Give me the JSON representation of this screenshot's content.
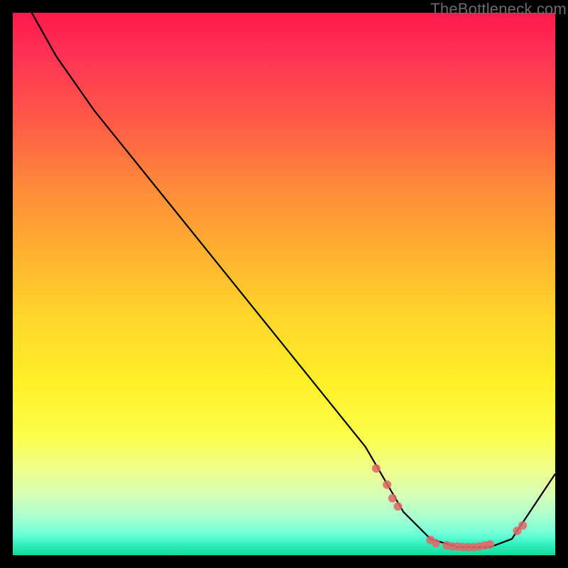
{
  "watermark": "TheBottleneck.com",
  "chart_data": {
    "type": "line",
    "title": "",
    "xlabel": "",
    "ylabel": "",
    "xlim": [
      0,
      100
    ],
    "ylim": [
      0,
      100
    ],
    "series": [
      {
        "name": "curve",
        "points": [
          {
            "x": 3.5,
            "y": 100
          },
          {
            "x": 8,
            "y": 92
          },
          {
            "x": 15,
            "y": 82
          },
          {
            "x": 65,
            "y": 20
          },
          {
            "x": 72,
            "y": 8
          },
          {
            "x": 77,
            "y": 3
          },
          {
            "x": 82,
            "y": 1.5
          },
          {
            "x": 88,
            "y": 1.5
          },
          {
            "x": 92,
            "y": 3
          },
          {
            "x": 100,
            "y": 15
          }
        ]
      },
      {
        "name": "dots",
        "points": [
          {
            "x": 67,
            "y": 16
          },
          {
            "x": 69,
            "y": 13
          },
          {
            "x": 70,
            "y": 10.5
          },
          {
            "x": 71,
            "y": 9
          },
          {
            "x": 77,
            "y": 2.8
          },
          {
            "x": 78,
            "y": 2.2
          },
          {
            "x": 80,
            "y": 1.8
          },
          {
            "x": 81,
            "y": 1.6
          },
          {
            "x": 82,
            "y": 1.6
          },
          {
            "x": 83,
            "y": 1.5
          },
          {
            "x": 84,
            "y": 1.5
          },
          {
            "x": 85,
            "y": 1.5
          },
          {
            "x": 86,
            "y": 1.6
          },
          {
            "x": 87,
            "y": 1.8
          },
          {
            "x": 88,
            "y": 2.0
          },
          {
            "x": 93,
            "y": 4.5
          },
          {
            "x": 94,
            "y": 5.5
          }
        ]
      }
    ]
  }
}
